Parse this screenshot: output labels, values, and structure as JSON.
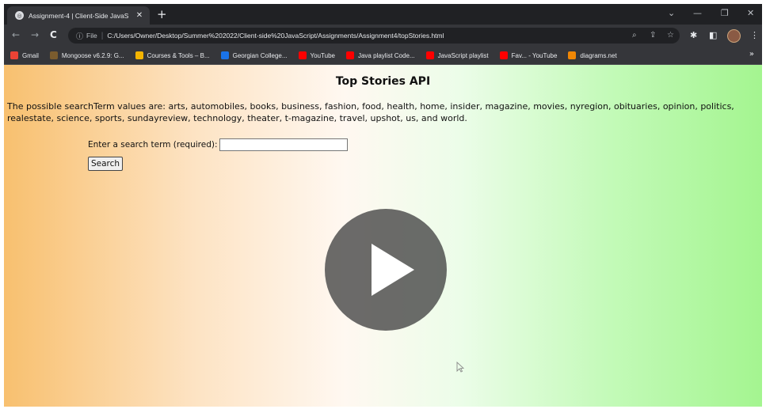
{
  "browser": {
    "tab": {
      "title": "Assignment-4 | Client-Side JavaS",
      "close": "✕"
    },
    "new_tab": "+",
    "window_controls": {
      "chevron": "⌄",
      "minimize": "—",
      "restore": "❐",
      "close": "✕"
    },
    "nav": {
      "back": "←",
      "forward": "→",
      "reload": "C"
    },
    "omnibox": {
      "info_icon": "ⓘ",
      "scheme_label": "File",
      "separator": "|",
      "url": "C:/Users/Owner/Desktop/Summer%202022/Client-side%20JavaScript/Assignments/Assignment4/topStories.html",
      "zoom_icon": "⌕",
      "share_icon": "⇪",
      "star_icon": "☆"
    },
    "toolbar_icons": {
      "extensions": "✱",
      "sidepanel": "◧",
      "menu": "⋮"
    },
    "bookmarks": [
      {
        "label": "Gmail",
        "icon_color": "#ea4335"
      },
      {
        "label": "Mongoose v6.2.9: G...",
        "icon_color": "#7a5c2e"
      },
      {
        "label": "Courses & Tools – B...",
        "icon_color": "#f4b400"
      },
      {
        "label": "Georgian College...",
        "icon_color": "#1a73e8"
      },
      {
        "label": "YouTube",
        "icon_color": "#ff0000"
      },
      {
        "label": "Java playlist Code...",
        "icon_color": "#ff0000"
      },
      {
        "label": "JavaScript playlist",
        "icon_color": "#ff0000"
      },
      {
        "label": "Fav... - YouTube",
        "icon_color": "#ff0000"
      },
      {
        "label": "diagrams.net",
        "icon_color": "#f08705"
      }
    ],
    "bookmarks_more": "»"
  },
  "page": {
    "title": "Top Stories API",
    "description": "The possible searchTerm values are: arts, automobiles, books, business, fashion, food, health, home, insider, magazine, movies, nyregion, obituaries, opinion, politics, realestate, science, sports, sundayreview, technology, theater, t-magazine, travel, upshot, us, and world.",
    "search_label": "Enter a search term (required):",
    "search_value": "",
    "search_button": "Search"
  },
  "colors": {
    "gradient_left": "#f8c06f",
    "gradient_mid": "#fff8f1",
    "gradient_right": "#a4f590",
    "play_overlay": "#4b4b4b"
  }
}
